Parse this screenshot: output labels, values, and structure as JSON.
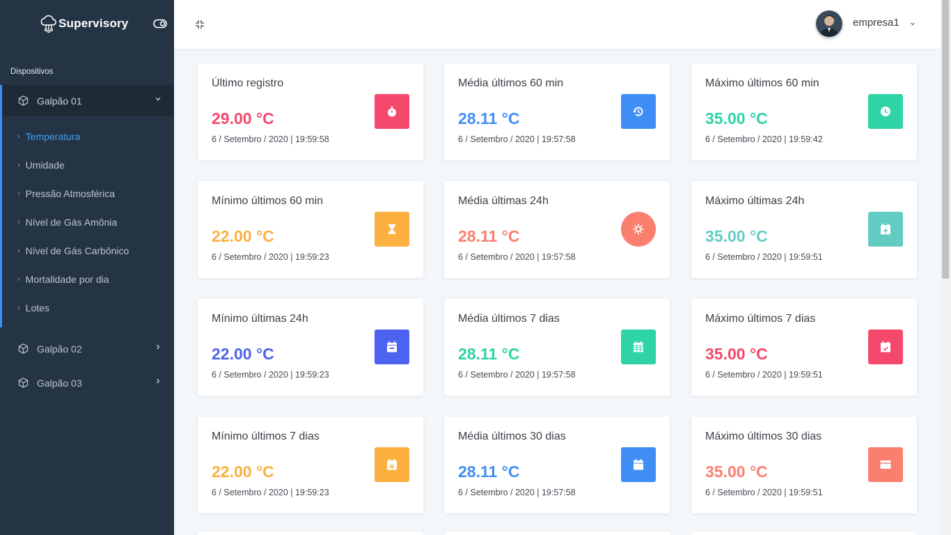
{
  "brand": {
    "name": "Supervisory"
  },
  "sidebar": {
    "section_label": "Dispositivos",
    "groups": [
      {
        "label": "Galpão 01",
        "expanded": true
      },
      {
        "label": "Galpão 02",
        "expanded": false
      },
      {
        "label": "Galpão 03",
        "expanded": false
      }
    ],
    "submenu": [
      {
        "label": "Temperatura",
        "active": true
      },
      {
        "label": "Umidade",
        "active": false
      },
      {
        "label": "Pressão Atmosférica",
        "active": false
      },
      {
        "label": "Nível de Gás Amônia",
        "active": false
      },
      {
        "label": "Nível de Gás Carbônico",
        "active": false
      },
      {
        "label": "Mortalidade por dia",
        "active": false
      },
      {
        "label": "Lotes",
        "active": false
      }
    ]
  },
  "header": {
    "user_name": "empresa1"
  },
  "colors": {
    "sidebar_bg": "#253445",
    "accent": "#3f9ff5",
    "red": "#f5486d",
    "blue": "#3f8ef5",
    "teal": "#2ed3a6",
    "orange": "#fbb03f",
    "salmon": "#fb7f6f",
    "lightteal": "#63ccc2",
    "indigo": "#4d62ee"
  },
  "cards": [
    {
      "title": "Último registro",
      "value": "29.00 °C",
      "date": "6 / Setembro / 2020 | 19:59:58",
      "color": "#f5486d",
      "icon": "stopwatch-icon"
    },
    {
      "title": "Média últimos 60 min",
      "value": "28.11 °C",
      "date": "6 / Setembro / 2020 | 19:57:58",
      "color": "#3f8ef5",
      "icon": "history-icon"
    },
    {
      "title": "Máximo últimos 60 min",
      "value": "35.00 °C",
      "date": "6 / Setembro / 2020 | 19:59:42",
      "color": "#2ed3a6",
      "icon": "clock-icon"
    },
    {
      "title": "Mínimo últimos 60 min",
      "value": "22.00 °C",
      "date": "6 / Setembro / 2020 | 19:59:23",
      "color": "#fbb03f",
      "icon": "hourglass-icon"
    },
    {
      "title": "Média últimas 24h",
      "value": "28.11 °C",
      "date": "6 / Setembro / 2020 | 19:57:58",
      "color": "#fb7f6f",
      "icon": "sun-icon"
    },
    {
      "title": "Máximo últimas 24h",
      "value": "35.00 °C",
      "date": "6 / Setembro / 2020 | 19:59:51",
      "color": "#63ccc2",
      "icon": "calendar-plus-icon"
    },
    {
      "title": "Mínimo últimas 24h",
      "value": "22.00 °C",
      "date": "6 / Setembro / 2020 | 19:59:23",
      "color": "#4d62ee",
      "icon": "calendar-minus-icon"
    },
    {
      "title": "Média últimos 7 dias",
      "value": "28.11 °C",
      "date": "6 / Setembro / 2020 | 19:57:58",
      "color": "#2ed3a6",
      "icon": "calendar-grid-icon"
    },
    {
      "title": "Máximo últimos 7 dias",
      "value": "35.00 °C",
      "date": "6 / Setembro / 2020 | 19:59:51",
      "color": "#f5486d",
      "icon": "calendar-check-icon"
    },
    {
      "title": "Mínimo últimos 7 dias",
      "value": "22.00 °C",
      "date": "6 / Setembro / 2020 | 19:59:23",
      "color": "#fbb03f",
      "icon": "calendar-x-icon"
    },
    {
      "title": "Média últimos 30 dias",
      "value": "28.11 °C",
      "date": "6 / Setembro / 2020 | 19:57:58",
      "color": "#3f8ef5",
      "icon": "calendar-icon"
    },
    {
      "title": "Máximo últimos 30 dias",
      "value": "35.00 °C",
      "date": "6 / Setembro / 2020 | 19:59:51",
      "color": "#fb7f6f",
      "icon": "calendar-blank-icon"
    }
  ]
}
